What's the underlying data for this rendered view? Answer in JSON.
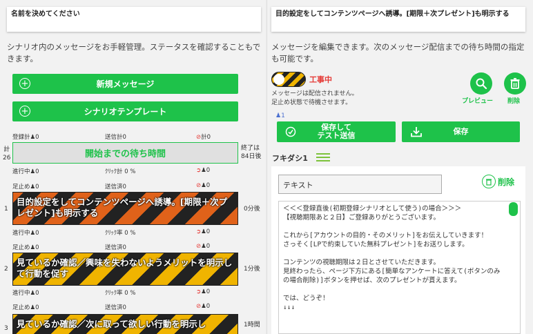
{
  "left": {
    "title": "名前を決めてください",
    "description": "シナリオ内のメッセージをお手軽管理。ステータスを確認することもできます。",
    "new_message_label": "新規メッセージ",
    "scenario_template_label": "シナリオテンプレート",
    "top_stats": {
      "registered": "登録計",
      "registered_val": "0",
      "sent": "送信計",
      "sent_val": "0",
      "blocked": "計",
      "blocked_val": "0"
    },
    "wait_label": "開始までの待ち時間",
    "side_left": "計\n26",
    "side_right": "終了は\n84日後",
    "row_labels": {
      "in_progress": "進行中",
      "click_total": "ｸﾘｯｸ計",
      "click_rate": "ｸﾘｯｸ率",
      "stopped": "足止め",
      "sent_done": "送信済",
      "zero": "0",
      "zero_pct": "0 %"
    },
    "messages": [
      {
        "num": "1",
        "text": "目的設定をしてコンテンツページへ誘導。[期限＋次プレゼント]も明示する",
        "delay": "0分後"
      },
      {
        "num": "2",
        "text": "見ているか確認／興味を失わないようメリットを明示して行動を促す",
        "delay": "1分後"
      },
      {
        "num": "3",
        "text": "見ているか確認／次に取って欲しい行動を明示し",
        "delay": "1時間"
      }
    ]
  },
  "right": {
    "title": "目的設定をしてコンテンツページへ誘導。[期限＋次プレゼント]も明示する",
    "description": "メッセージを編集できます。次のメッセージ配信までの待ち時間の指定も可能です。",
    "status_label": "工事中",
    "status_note": "メッセージは配信されません。\n足止め状態で待機させます。",
    "preview_label": "プレビュー",
    "delete_label": "削除",
    "user_count": "1",
    "save_test_label": "保存して\nテスト送信",
    "save_label": "保存",
    "balloon_label": "フキダシ1",
    "text_type": "テキスト",
    "balloon_delete_label": "削除",
    "message_body": "＜＜＜登録直後(初期登録シナリオとして使う)の場合＞＞＞\n【視聴期限あと２日】ご登録ありがとうございます。\n\nこれから[アカウントの目的・そのメリット]をお伝えしていきます！\nさっそく[LPで約束していた無料プレゼント]をお送りします。\n\nコンテンツの視聴期限は２日とさせていただきます。\n見終わったら、ページ下方にある[簡単なアンケートに答えて(ボタンのみの場合削除)]ボタンを押せば、次のプレゼントが貰えます。\n\nでは、どうぞ！\n↓↓↓"
  },
  "colors": {
    "accent": "#1ec24a",
    "danger": "#e53935",
    "stripe_orange": "#e0621a",
    "stripe_yellow": "#f0b400"
  }
}
